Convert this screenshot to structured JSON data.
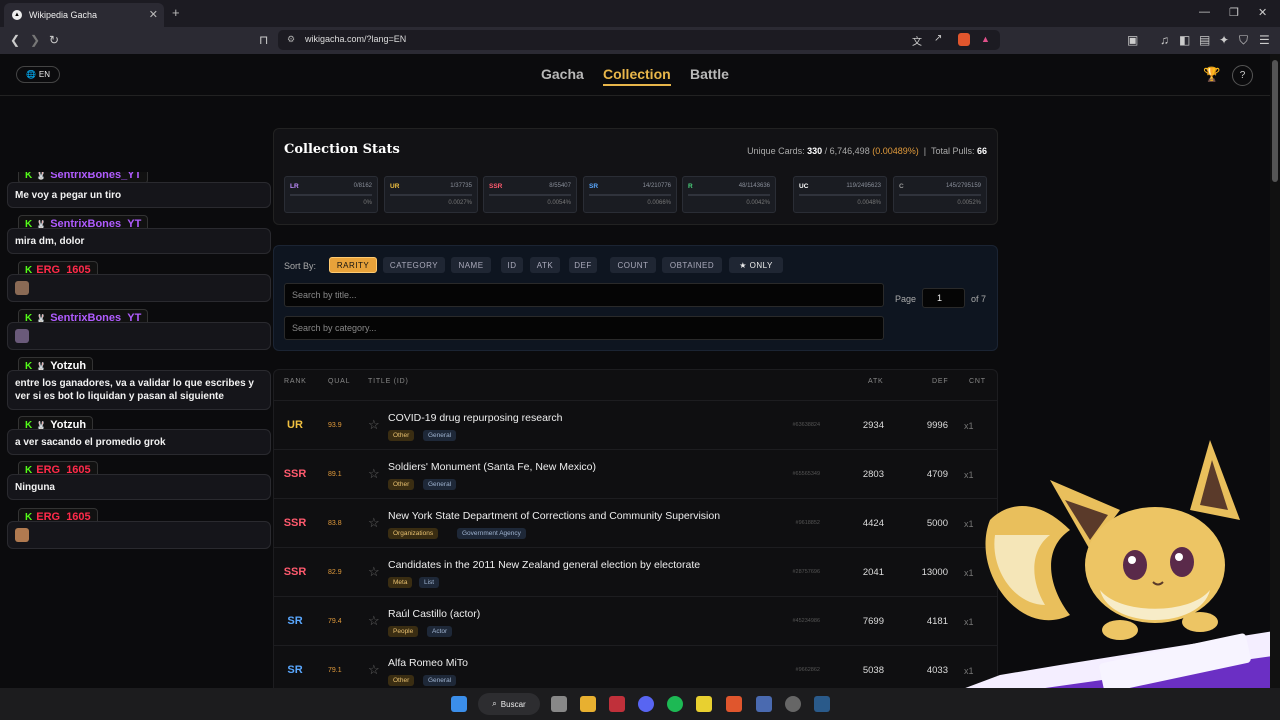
{
  "browser": {
    "tab_title": "Wikipedia Gacha",
    "url": "wikigacha.com/?lang=EN"
  },
  "nav": {
    "lang": "EN",
    "links": [
      "Gacha",
      "Collection",
      "Battle"
    ],
    "active": "Collection",
    "help": "?"
  },
  "chat": [
    {
      "user": "SentrixBones_YT",
      "color": "#b05cff",
      "text": "Me voy a pegar un tiro"
    },
    {
      "user": "SentrixBones_YT",
      "color": "#b05cff",
      "text": "mira dm, dolor"
    },
    {
      "user": "ERG_1605",
      "color": "#ff2a4a",
      "text": ""
    },
    {
      "user": "SentrixBones_YT",
      "color": "#b05cff",
      "text": ""
    },
    {
      "user": "Yotzuh",
      "color": "#ffffff",
      "text": "entre los ganadores, va a validar lo que escribes y ver si es bot lo liquidan y pasan al siguiente"
    },
    {
      "user": "Yotzuh",
      "color": "#ffffff",
      "text": "a ver sacando el promedio grok"
    },
    {
      "user": "ERG_1605",
      "color": "#ff2a4a",
      "text": "Ninguna"
    },
    {
      "user": "ERG_1605",
      "color": "#ff2a4a",
      "text": ""
    }
  ],
  "stats": {
    "title": "Collection Stats",
    "unique_label": "Unique Cards:",
    "unique_owned": "330",
    "unique_total": "6,746,498",
    "unique_pct": "(0.00489%)",
    "pulls_label": "Total Pulls:",
    "pulls": "66",
    "rarities": [
      {
        "label": "LR",
        "value": "0/8162",
        "pct": "0%",
        "color": "#c08cff"
      },
      {
        "label": "UR",
        "value": "1/37735",
        "pct": "0.0027%",
        "color": "#f0c040"
      },
      {
        "label": "SSR",
        "value": "8/55407",
        "pct": "0.0054%",
        "color": "#ff5a6e"
      },
      {
        "label": "SR",
        "value": "14/210776",
        "pct": "0.0066%",
        "color": "#5aa8ff"
      },
      {
        "label": "R",
        "value": "48/1143636",
        "pct": "0.0042%",
        "color": "#4ad07a"
      },
      {
        "label": "UC",
        "value": "119/2495623",
        "pct": "0.0048%",
        "color": "#ffffff"
      },
      {
        "label": "C",
        "value": "145/2795159",
        "pct": "0.0052%",
        "color": "#999999"
      }
    ]
  },
  "sort": {
    "label": "Sort By:",
    "options": [
      "RARITY",
      "CATEGORY",
      "NAME",
      "ID",
      "ATK",
      "DEF",
      "COUNT",
      "OBTAINED",
      "★ ONLY"
    ],
    "active": "RARITY",
    "title_placeholder": "Search by title...",
    "category_placeholder": "Search by category...",
    "page_label": "Page",
    "page": "1",
    "page_of": "of 7"
  },
  "table": {
    "headers": [
      "RANK",
      "QUAL",
      "TITLE (ID)",
      "ATK",
      "DEF",
      "CNT"
    ],
    "rows": [
      {
        "rank": "UR",
        "rank_color": "#f0c040",
        "qual": "93.9",
        "title": "COVID-19 drug repurposing research",
        "tags": [
          "Other",
          "General"
        ],
        "id": "#63638824",
        "atk": "2934",
        "def": "9996",
        "cnt": "x1"
      },
      {
        "rank": "SSR",
        "rank_color": "#ff5a6e",
        "qual": "89.1",
        "title": "Soldiers' Monument (Santa Fe, New Mexico)",
        "tags": [
          "Other",
          "General"
        ],
        "id": "#65565349",
        "atk": "2803",
        "def": "4709",
        "cnt": "x1"
      },
      {
        "rank": "SSR",
        "rank_color": "#ff5a6e",
        "qual": "83.8",
        "title": "New York State Department of Corrections and Community Supervision",
        "tags": [
          "Organizations",
          "Government Agency"
        ],
        "id": "#9618852",
        "atk": "4424",
        "def": "5000",
        "cnt": "x1"
      },
      {
        "rank": "SSR",
        "rank_color": "#ff5a6e",
        "qual": "82.9",
        "title": "Candidates in the 2011 New Zealand general election by electorate",
        "tags": [
          "Meta",
          "List"
        ],
        "id": "#28757696",
        "atk": "2041",
        "def": "13000",
        "cnt": "x1"
      },
      {
        "rank": "SR",
        "rank_color": "#5aa8ff",
        "qual": "79.4",
        "title": "Raúl Castillo (actor)",
        "tags": [
          "People",
          "Actor"
        ],
        "id": "#45234986",
        "atk": "7699",
        "def": "4181",
        "cnt": "x1"
      },
      {
        "rank": "SR",
        "rank_color": "#5aa8ff",
        "qual": "79.1",
        "title": "Alfa Romeo MiTo",
        "tags": [
          "Other",
          "General"
        ],
        "id": "#9662862",
        "atk": "5038",
        "def": "4033",
        "cnt": "x1"
      }
    ]
  },
  "taskbar": {
    "search": "Buscar"
  }
}
